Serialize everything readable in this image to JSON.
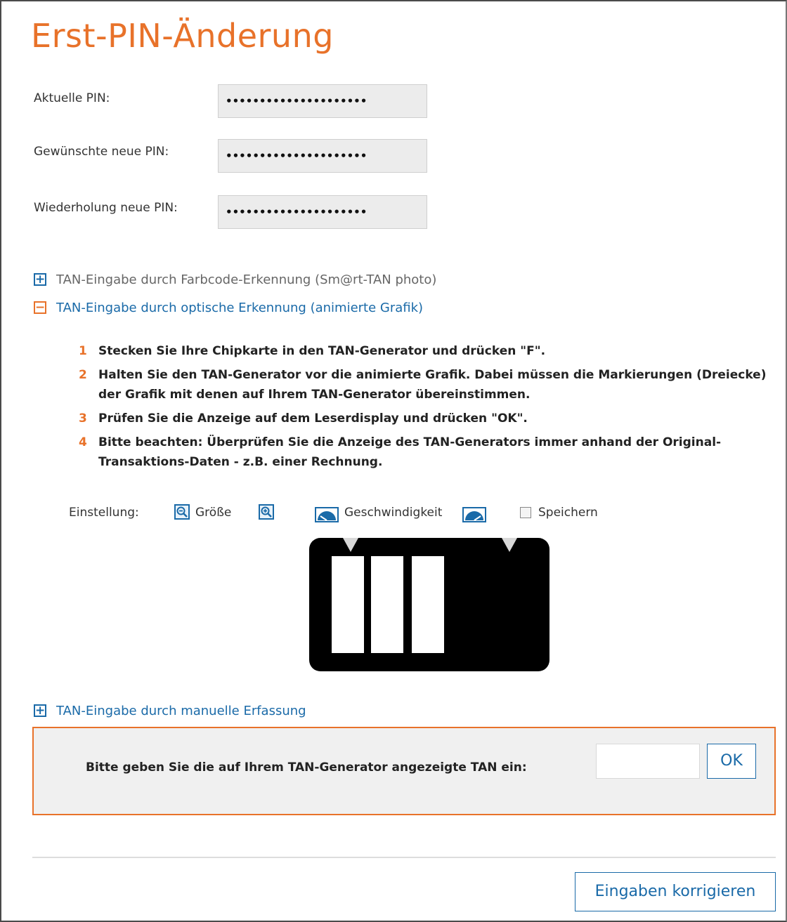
{
  "title": "Erst-PIN-Änderung",
  "pin_fields": [
    {
      "label": "Aktuelle PIN:",
      "value": "•••••••••••••••••••••"
    },
    {
      "label": "Gewünschte neue PIN:",
      "value": "•••••••••••••••••••••"
    },
    {
      "label": "Wiederholung neue PIN:",
      "value": "•••••••••••••••••••••"
    }
  ],
  "tan_options": [
    {
      "symbol": "+",
      "label": "TAN-Eingabe durch Farbcode-Erkennung (Sm@rt-TAN photo)",
      "expanded": false
    },
    {
      "symbol": "−",
      "label": "TAN-Eingabe durch optische Erkennung (animierte Grafik)",
      "expanded": true
    },
    {
      "symbol": "+",
      "label": "TAN-Eingabe durch manuelle Erfassung",
      "expanded": false
    }
  ],
  "steps": [
    {
      "num": "1",
      "text": "Stecken Sie Ihre Chipkarte in den TAN-Generator und drücken \"F\"."
    },
    {
      "num": "2",
      "text": "Halten Sie den TAN-Generator vor die animierte Grafik. Dabei müssen die Markierungen (Dreiecke) der Grafik mit denen auf Ihrem TAN-Generator übereinstimmen."
    },
    {
      "num": "3",
      "text": "Prüfen Sie die Anzeige auf dem Leserdisplay und drücken \"OK\"."
    },
    {
      "num": "4",
      "text": "Bitte beachten: Überprüfen Sie die Anzeige des TAN-Generators immer anhand der Original-Transaktions-Daten - z.B. einer Rechnung."
    }
  ],
  "settings": {
    "label": "Einstellung:",
    "size_label": "Größe",
    "speed_label": "Geschwindigkeit",
    "save_label": "Speichern",
    "save_checked": false
  },
  "tan_entry": {
    "prompt": "Bitte geben Sie die auf Ihrem TAN-Generator angezeigte TAN ein:",
    "value": "",
    "ok_label": "OK"
  },
  "correct_button": "Eingaben korrigieren",
  "colors": {
    "accent": "#e8722a",
    "link": "#1a6aa8"
  }
}
